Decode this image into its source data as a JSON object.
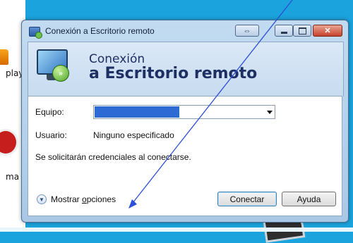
{
  "desktop": {
    "icons": [
      {
        "label": "play",
        "icon": "app-icon-orange"
      },
      {
        "label": "ma",
        "icon": "app-icon-red"
      }
    ]
  },
  "window": {
    "title": "Conexión a Escritorio remoto",
    "title_icon": "remote-desktop-icon",
    "controls": [
      "swap-screen-icon",
      "minimize-icon",
      "maximize-icon",
      "close-icon"
    ],
    "header": {
      "line1": "Conexión",
      "line2": "a Escritorio remoto",
      "icon": "remote-desktop-monitor-icon"
    },
    "form": {
      "computer_label": "Equipo:",
      "computer_value": "",
      "user_label": "Usuario:",
      "user_value": "Ninguno especificado",
      "credentials_note": "Se solicitarán credenciales al conectarse."
    },
    "options": {
      "label_prefix": "Mostrar ",
      "label_underlined": "o",
      "label_rest": "pciones",
      "icon": "expand-down-icon"
    },
    "buttons": {
      "connect": "Conectar",
      "help": "Ayuda"
    }
  },
  "annotation": {
    "color": "#2b4fd8",
    "type": "arrow"
  }
}
